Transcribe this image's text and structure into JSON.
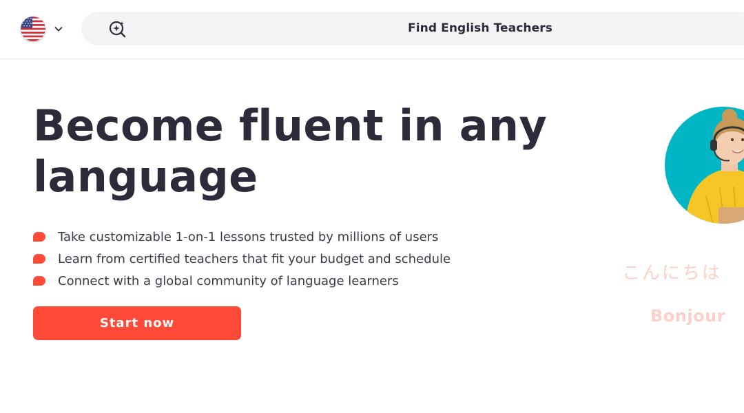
{
  "header": {
    "language_flag": "us-flag-icon",
    "search": {
      "icon": "search-sparkle-icon",
      "label": "Find English Teachers"
    }
  },
  "hero": {
    "title": "Become fluent in any language",
    "benefits": [
      "Take customizable 1-on-1 lessons trusted by millions of users",
      "Learn from certified teachers that fit your budget and schedule",
      "Connect with a global community of language learners"
    ],
    "cta_label": "Start now"
  },
  "illustration": {
    "greetings": [
      "こんにちは",
      "Bonjour"
    ]
  },
  "colors": {
    "accent": "#ff4a38",
    "bullet": "#ff4a38",
    "photo_background": "#00b5c4",
    "greeting_text": "#fbd0ca",
    "title_text": "#2d2b3a"
  }
}
